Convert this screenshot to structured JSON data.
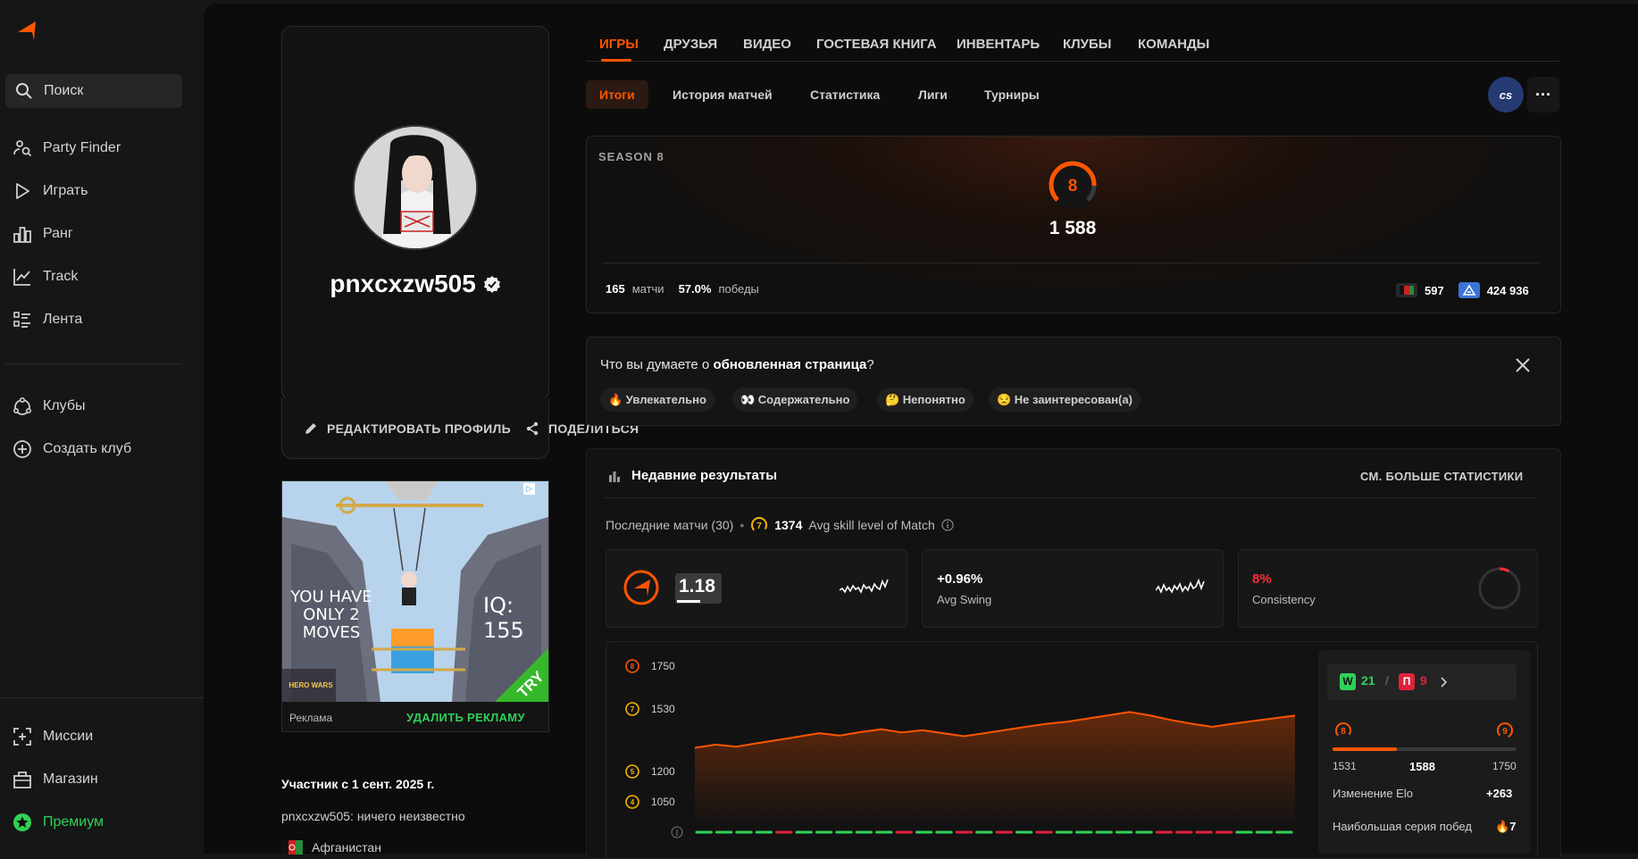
{
  "sidebar": {
    "search_label": "Поиск",
    "items": [
      {
        "label": "Party Finder",
        "icon": "party-finder-icon"
      },
      {
        "label": "Играть",
        "icon": "play-icon"
      },
      {
        "label": "Ранг",
        "icon": "rank-icon"
      },
      {
        "label": "Track",
        "icon": "track-icon"
      },
      {
        "label": "Лента",
        "icon": "feed-icon"
      },
      {
        "label": "Клубы",
        "icon": "clubs-icon"
      },
      {
        "label": "Создать клуб",
        "icon": "create-club-icon"
      }
    ],
    "bottom": [
      {
        "label": "Миссии",
        "icon": "missions-icon"
      },
      {
        "label": "Магазин",
        "icon": "shop-icon"
      },
      {
        "label": "Премиум",
        "icon": "premium-icon"
      }
    ],
    "accent": "#ff5500",
    "premium_color": "#30d158"
  },
  "profile": {
    "username": "pnxcxzw505",
    "edit_label": "РЕДАКТИРОВАТЬ ПРОФИЛЬ",
    "share_label": "ПОДЕЛИТЬСЯ",
    "member_since": "Участник с 1 сент. 2025 г.",
    "bio": "pnxcxzw505: ничего неизвестно",
    "country": "Афганистан"
  },
  "ad": {
    "text_left": "YOU HAVE ONLY 2 MOVES",
    "text_right": "IQ: 155",
    "try_label": "TRY",
    "brand": "HERO WARS",
    "label": "Реклама",
    "remove_label": "УДАЛИТЬ РЕКЛАМУ"
  },
  "tabs": [
    "ИГРЫ",
    "ДРУЗЬЯ",
    "ВИДЕО",
    "ГОСТЕВАЯ КНИГА",
    "ИНВЕНТАРЬ",
    "КЛУБЫ",
    "КОМАНДЫ"
  ],
  "subtabs": [
    "Итоги",
    "История матчей",
    "Статистика",
    "Лиги",
    "Турниры"
  ],
  "game_badge": "cs",
  "season": {
    "label": "SEASON 8",
    "level": "8",
    "elo": "1 588",
    "matches_value": "165",
    "matches_label": "матчи",
    "winrate_value": "57.0%",
    "winrate_label": "победы",
    "country_rank": "597",
    "world_rank": "424 936"
  },
  "feedback": {
    "question_prefix": "Что вы думаете о ",
    "question_bold": "обновленная страница",
    "question_suffix": "?",
    "options": [
      "🔥 Увлекательно",
      "👀 Содержательно",
      "🤔 Непонятно",
      "😒 Не заинтересован(а)"
    ]
  },
  "results": {
    "title": "Недавние результаты",
    "more_label": "СМ. БОЛЬШЕ СТАТИСТИКИ",
    "last_matches": "Последние матчи (30)",
    "avg_level_icon": "7",
    "avg_skill_value": "1374",
    "avg_skill_label": "Avg skill level of Match",
    "kd": "1.18",
    "avg_swing_value": "+0.96%",
    "avg_swing_label": "Avg Swing",
    "consistency_value": "8%",
    "consistency_label": "Consistency",
    "wins": "21",
    "losses": "9",
    "win_letter": "W",
    "loss_letter": "П",
    "level_from": "8",
    "level_to": "9",
    "range_from": "1531",
    "range_current": "1588",
    "range_to": "1750",
    "elo_change_label": "Изменение Elo",
    "elo_change_value": "+263",
    "streak_label": "Наибольшая серия побед",
    "streak_value": "7"
  },
  "chart_data": {
    "type": "area",
    "y_ticks": [
      {
        "value": 1750,
        "level": "8"
      },
      {
        "value": 1530,
        "level": "7"
      },
      {
        "value": 1200,
        "level": "5"
      },
      {
        "value": 1050,
        "level": "4"
      }
    ],
    "values": [
      1325,
      1342,
      1331,
      1349,
      1366,
      1384,
      1402,
      1390,
      1408,
      1423,
      1406,
      1418,
      1402,
      1386,
      1402,
      1419,
      1436,
      1452,
      1463,
      1480,
      1497,
      1514,
      1496,
      1472,
      1452,
      1436,
      1452,
      1467,
      1481,
      1495
    ],
    "results": [
      "W",
      "W",
      "W",
      "W",
      "L",
      "W",
      "W",
      "W",
      "W",
      "W",
      "L",
      "W",
      "W",
      "L",
      "W",
      "L",
      "W",
      "L",
      "W",
      "W",
      "W",
      "W",
      "W",
      "L",
      "L",
      "L",
      "L",
      "W",
      "W",
      "W"
    ],
    "line_color": "#ff5500",
    "win_color": "#30d158",
    "loss_color": "#e0223b"
  }
}
